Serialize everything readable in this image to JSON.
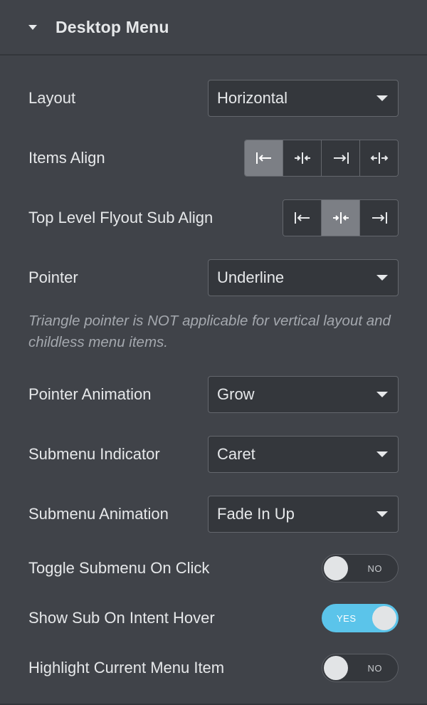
{
  "section": {
    "title": "Desktop Menu",
    "collapse_icon": "caret-down-icon"
  },
  "layout": {
    "label": "Layout",
    "value": "Horizontal"
  },
  "items_align": {
    "label": "Items Align",
    "options": [
      {
        "icon": "align-start-icon",
        "active": true
      },
      {
        "icon": "align-center-icon",
        "active": false
      },
      {
        "icon": "align-end-icon",
        "active": false
      },
      {
        "icon": "align-justify-icon",
        "active": false
      }
    ]
  },
  "flyout_align": {
    "label": "Top Level Flyout Sub Align",
    "options": [
      {
        "icon": "align-start-icon",
        "active": false
      },
      {
        "icon": "align-center-icon",
        "active": true
      },
      {
        "icon": "align-end-icon",
        "active": false
      }
    ]
  },
  "pointer": {
    "label": "Pointer",
    "value": "Underline",
    "note": "Triangle pointer is NOT applicable for vertical layout and childless menu items."
  },
  "pointer_animation": {
    "label": "Pointer Animation",
    "value": "Grow"
  },
  "submenu_indicator": {
    "label": "Submenu Indicator",
    "value": "Caret"
  },
  "submenu_animation": {
    "label": "Submenu Animation",
    "value": "Fade In Up"
  },
  "toggle_submenu": {
    "label": "Toggle Submenu On Click",
    "state": "NO"
  },
  "intent_hover": {
    "label": "Show Sub On Intent Hover",
    "state": "YES"
  },
  "highlight_current": {
    "label": "Highlight Current Menu Item",
    "state": "NO"
  },
  "colors": {
    "panel_bg": "#404349",
    "control_bg": "#34373c",
    "active_segment": "#7c7f85",
    "toggle_on": "#5bc4ea",
    "note_text": "#a4a8ae"
  }
}
